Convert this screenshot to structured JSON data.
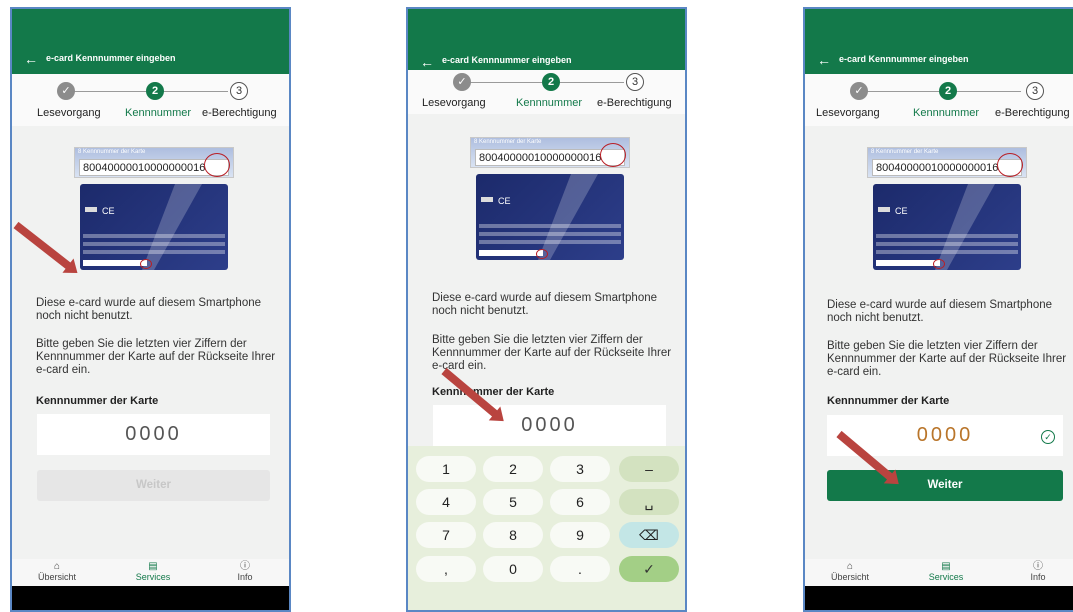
{
  "appbar": {
    "back_icon": "←",
    "title": "e-card Kennnummer eingeben"
  },
  "steps": [
    {
      "number": "1",
      "label": "Lesevorgang",
      "state": "done",
      "icon": "check-icon"
    },
    {
      "number": "2",
      "label": "Kennnummer",
      "state": "active"
    },
    {
      "number": "3",
      "label": "e-Berechtigung",
      "state": "pending"
    }
  ],
  "card_image": {
    "label": "8 Kennnummer der Karte",
    "number": "80040000010000000016"
  },
  "text": {
    "notice": "Diese e-card wurde auf diesem Smartphone noch nicht benutzt.",
    "instruction": "Bitte geben Sie die letzten vier Ziffern der Kennnummer der Karte auf der Rückseite Ihrer e-card ein.",
    "field_label": "Kennnummer der Karte"
  },
  "screens": [
    {
      "input_value": "0000",
      "button_label": "Weiter",
      "button_state": "disabled"
    },
    {
      "input_value": "0000",
      "button_label": "",
      "button_state": "hidden",
      "keyboard_open": true
    },
    {
      "input_value": "0000",
      "button_label": "Weiter",
      "button_state": "enabled",
      "input_valid": true
    }
  ],
  "keyboard": {
    "keys": [
      "1",
      "2",
      "3",
      "–",
      "4",
      "5",
      "6",
      "␣",
      "7",
      "8",
      "9",
      "⌫",
      ",",
      "0",
      ".",
      "✓"
    ]
  },
  "bottomnav": [
    {
      "label": "Übersicht",
      "icon": "home-icon",
      "glyph": "⌂",
      "active": false
    },
    {
      "label": "Services",
      "icon": "services-icon",
      "glyph": "▤",
      "active": true
    },
    {
      "label": "Info",
      "icon": "info-icon",
      "glyph": "ⓘ",
      "active": false
    }
  ],
  "colors": {
    "brand": "#13794a",
    "highlight": "#b91e25",
    "arrow": "#b9443f"
  }
}
